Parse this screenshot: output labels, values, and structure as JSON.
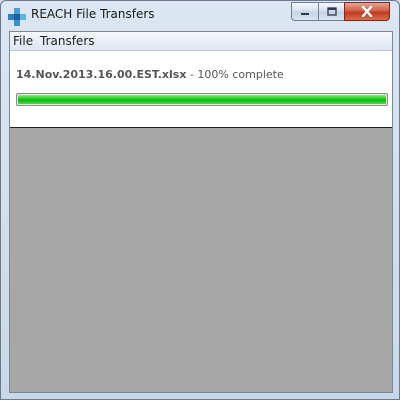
{
  "window": {
    "title": "REACH File Transfers",
    "icon": "reach-app-icon",
    "controls": {
      "minimize": "minimize-icon",
      "maximize": "maximize-icon",
      "close": "close-icon"
    }
  },
  "menu": {
    "items": [
      {
        "label": "File"
      },
      {
        "label": "Transfers"
      }
    ]
  },
  "transfer": {
    "filename": "14.Nov.2013.16.00.EST.xlsx",
    "status": " - 100% complete",
    "progress_percent": 100
  },
  "colors": {
    "progress_green": "#18c818",
    "close_red": "#c2391f",
    "client_background": "#a7a7a7"
  }
}
